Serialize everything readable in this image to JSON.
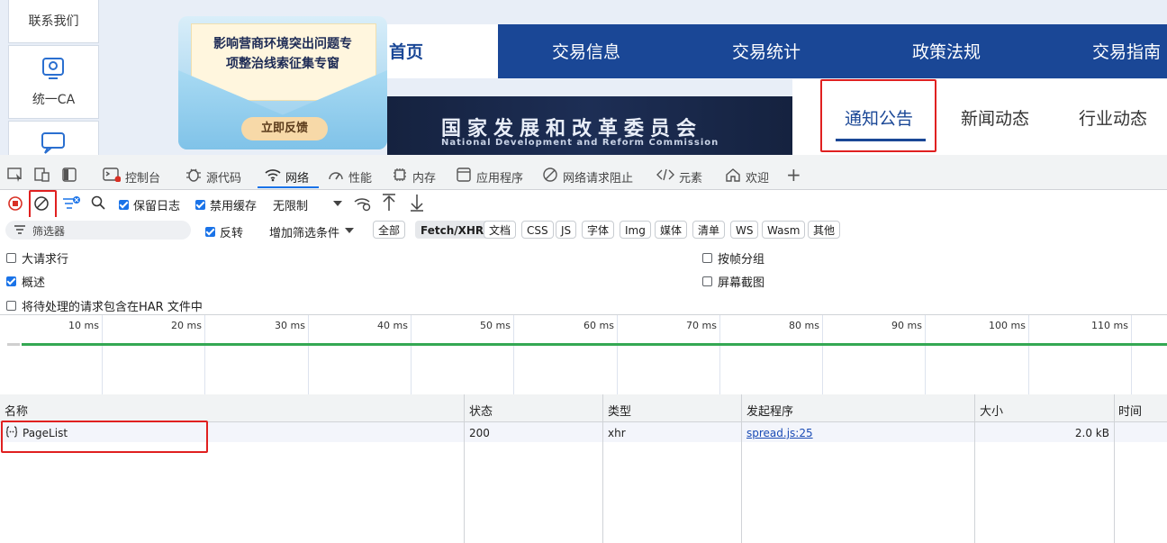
{
  "site": {
    "side_cards": [
      {
        "label": "联系我们",
        "icon": "contact-icon"
      },
      {
        "label": "统一CA",
        "icon": "ca-certificate-icon"
      },
      {
        "label": "",
        "icon": "chat-icon"
      }
    ],
    "banner": {
      "title_line1": "影响营商环境突出问题专",
      "title_line2": "项整治线索征集专窗",
      "button": "立即反馈"
    },
    "nav": [
      "首页",
      "交易信息",
      "交易统计",
      "政策法规",
      "交易指南"
    ],
    "hero": {
      "cn": "国家发展和改革委员会",
      "en": "National Development and Reform Commission"
    },
    "news_tabs": [
      "通知公告",
      "新闻动态",
      "行业动态"
    ]
  },
  "devtools": {
    "tabs": [
      {
        "label": "控制台",
        "icon": "console-icon"
      },
      {
        "label": "源代码",
        "icon": "bug-icon"
      },
      {
        "label": "网络",
        "icon": "wifi-icon"
      },
      {
        "label": "性能",
        "icon": "performance-icon"
      },
      {
        "label": "内存",
        "icon": "memory-icon"
      },
      {
        "label": "应用程序",
        "icon": "application-icon"
      },
      {
        "label": "网络请求阻止",
        "icon": "block-icon"
      },
      {
        "label": "元素",
        "icon": "code-icon"
      },
      {
        "label": "欢迎",
        "icon": "home-icon"
      }
    ],
    "toolbar": {
      "preserve_log": "保留日志",
      "disable_cache": "禁用缓存",
      "throttling": "无限制"
    },
    "filter": {
      "placeholder": "筛选器",
      "invert": "反转",
      "more_filters": "增加筛选条件",
      "types": [
        "全部",
        "Fetch/XHR",
        "文档",
        "CSS",
        "JS",
        "字体",
        "Img",
        "媒体",
        "清单",
        "WS",
        "Wasm",
        "其他"
      ],
      "selected": "Fetch/XHR"
    },
    "options": {
      "big_rows": "大请求行",
      "group_by_frame": "按帧分组",
      "overview": "概述",
      "screenshots": "屏幕截图",
      "har": "将待处理的请求包含在HAR 文件中"
    },
    "timeline_ticks": [
      "10 ms",
      "20 ms",
      "30 ms",
      "40 ms",
      "50 ms",
      "60 ms",
      "70 ms",
      "80 ms",
      "90 ms",
      "100 ms",
      "110 ms"
    ],
    "columns": [
      "名称",
      "状态",
      "类型",
      "发起程序",
      "大小",
      "时间"
    ],
    "rows": [
      {
        "name": "PageList",
        "status": "200",
        "type": "xhr",
        "initiator": "spread.js:25",
        "size": "2.0 kB",
        "time": ""
      }
    ]
  }
}
